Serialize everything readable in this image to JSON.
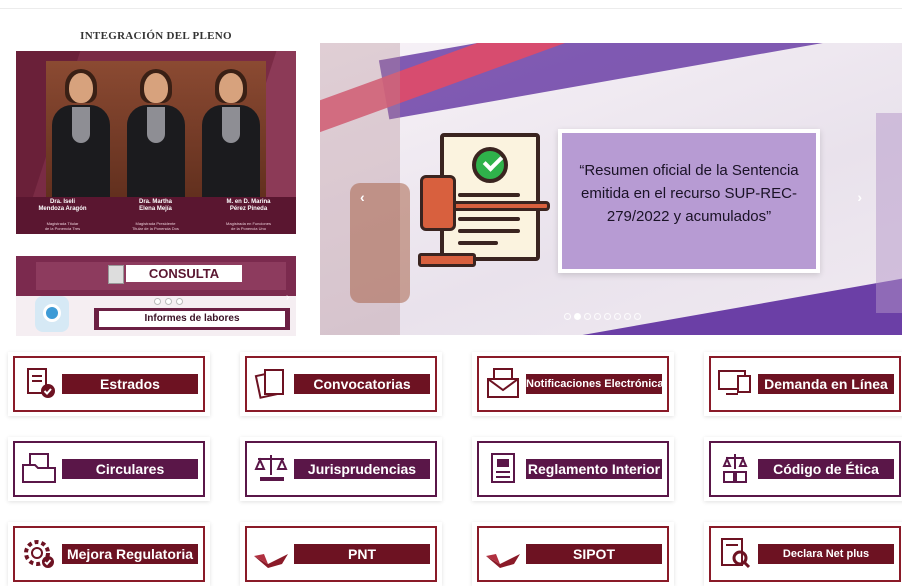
{
  "pleno": {
    "title": "INTEGRACIÓN DEL PLENO",
    "members": [
      {
        "name": "Dra. Iseli\nMendoza Aragón",
        "role": "Magistrada Titular\nde la Ponencia Tres"
      },
      {
        "name": "Dra. Martha\nElena Mejía",
        "role": "Magistrada Presidente\nTitular de la Ponencia Dos"
      },
      {
        "name": "M. en D. Marina\nPérez Pineda",
        "role": "Magistrada en Funciones\nde la Ponencia Uno"
      }
    ]
  },
  "consulta": {
    "title": "CONSULTA",
    "button": "Informes de labores"
  },
  "carousel": {
    "quote": "“Resumen oficial de la Sentencia emitida en el recurso SUP-REC-279/2022 y acumulados”",
    "slides": 8,
    "active_slide": 2
  },
  "tiles": [
    {
      "label": "Estrados",
      "icon": "document-check-icon",
      "theme": "red"
    },
    {
      "label": "Convocatorias",
      "icon": "documents-icon",
      "theme": "red"
    },
    {
      "label": "Notificaciones Electrónicas",
      "icon": "envelope-letter-icon",
      "theme": "red"
    },
    {
      "label": "Demanda en Línea",
      "icon": "computer-document-icon",
      "theme": "red"
    },
    {
      "label": "Circulares",
      "icon": "folder-document-icon",
      "theme": "purple"
    },
    {
      "label": "Jurisprudencias",
      "icon": "scales-gavel-icon",
      "theme": "purple"
    },
    {
      "label": "Reglamento Interior",
      "icon": "rulebook-icon",
      "theme": "purple"
    },
    {
      "label": "Código de Ética",
      "icon": "ethics-book-icon",
      "theme": "purple"
    },
    {
      "label": "Mejora Regulatoria",
      "icon": "gear-check-icon",
      "theme": "red"
    },
    {
      "label": "PNT",
      "icon": "pnt-logo-icon",
      "theme": "red"
    },
    {
      "label": "SIPOT",
      "icon": "sipot-logo-icon",
      "theme": "red"
    },
    {
      "label": "Declara Net plus",
      "icon": "document-magnifier-icon",
      "theme": "red"
    }
  ],
  "colors": {
    "maroon": "#6d1222",
    "purple": "#5a1648",
    "quote_box": "#b79bd3"
  }
}
